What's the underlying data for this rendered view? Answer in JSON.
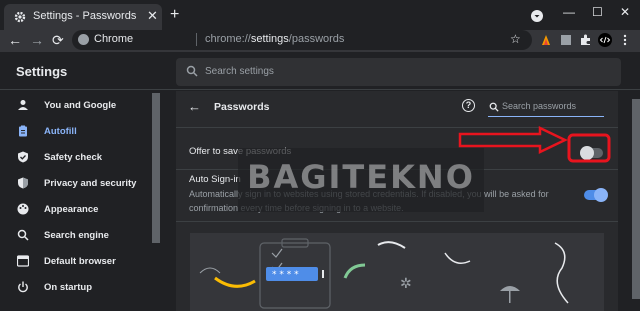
{
  "browser": {
    "tab_title": "Settings - Passwords",
    "tab_close": "✕",
    "new_tab": "+",
    "window_controls": [
      "—",
      "☐",
      "✕"
    ],
    "omnibox_site": "Chrome",
    "omnibox_url_prefix": "chrome://",
    "omnibox_url_bold": "settings",
    "omnibox_url_suffix": "/passwords",
    "back_arrow": "←",
    "forward_arrow": "→",
    "reload": "⟳",
    "star": "☆"
  },
  "settings": {
    "title": "Settings",
    "search_placeholder": "Search settings"
  },
  "sidebar": {
    "items": [
      {
        "label": "You and Google",
        "icon": "person-icon"
      },
      {
        "label": "Autofill",
        "icon": "clipboard-icon",
        "active": true
      },
      {
        "label": "Safety check",
        "icon": "shield-check-icon"
      },
      {
        "label": "Privacy and security",
        "icon": "shield-icon"
      },
      {
        "label": "Appearance",
        "icon": "palette-icon"
      },
      {
        "label": "Search engine",
        "icon": "search-icon"
      },
      {
        "label": "Default browser",
        "icon": "browser-icon"
      },
      {
        "label": "On startup",
        "icon": "power-icon"
      }
    ]
  },
  "passwords": {
    "back_arrow": "←",
    "title": "Passwords",
    "help": "?",
    "search_placeholder": "Search passwords",
    "offer_label": "Offer to save passwords",
    "offer_enabled": false,
    "autosignin_label": "Auto Sign-in",
    "autosignin_desc": "Automatically sign in to websites using stored credentials. If disabled, you will be asked for confirmation every time before signing in to a website.",
    "autosignin_enabled": true,
    "illustration_mask": "* * * *"
  },
  "watermark": "BAGITEKNO",
  "colors": {
    "accent": "#8ab4f8",
    "toggle_on": "#4f8de8",
    "annotation_red": "#e8141e",
    "background": "#202124",
    "panel": "#292a2d"
  }
}
